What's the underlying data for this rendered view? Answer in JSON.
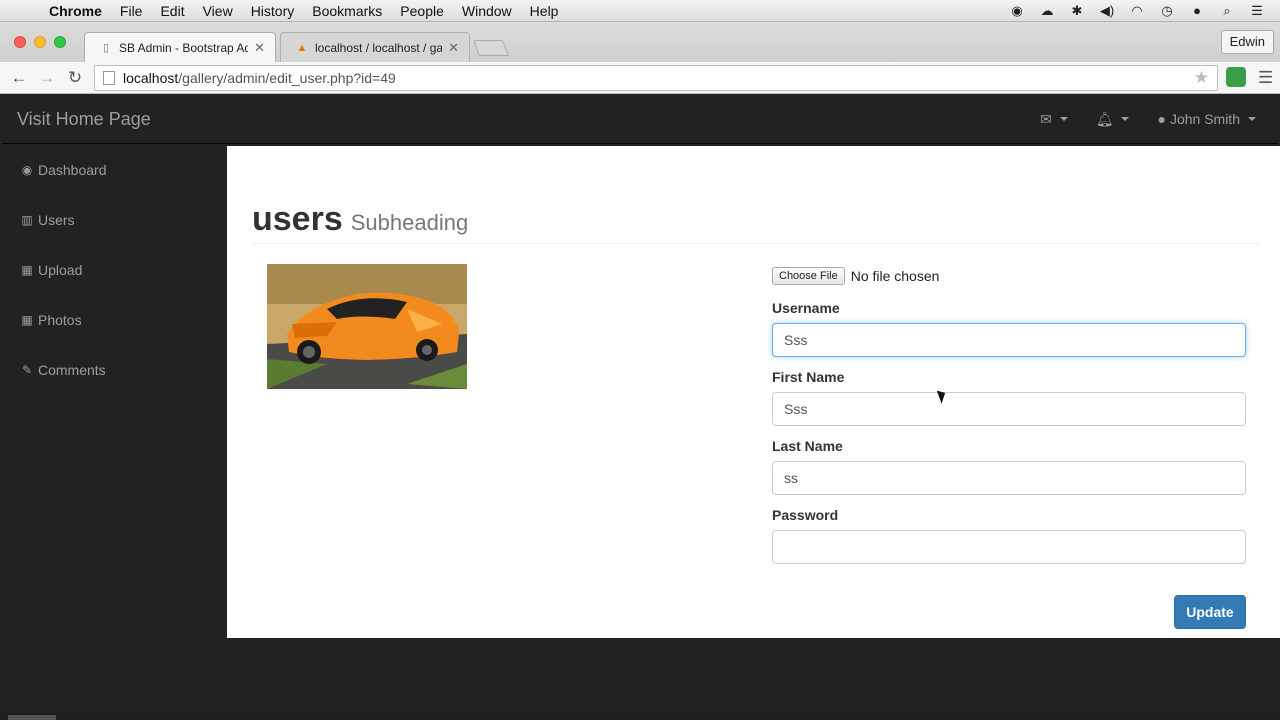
{
  "os_menubar": {
    "app": "Chrome",
    "items": [
      "File",
      "Edit",
      "View",
      "History",
      "Bookmarks",
      "People",
      "Window",
      "Help"
    ]
  },
  "browser": {
    "tabs": [
      {
        "title": "SB Admin - Bootstrap Adm",
        "active": true
      },
      {
        "title": "localhost / localhost / galle",
        "active": false
      }
    ],
    "profile": "Edwin",
    "url_host": "localhost",
    "url_path": "/gallery/admin/edit_user.php?id=49"
  },
  "topnav": {
    "brand": "Visit Home Page",
    "user": "John Smith"
  },
  "sidebar": {
    "items": [
      {
        "label": "Dashboard",
        "icon": "dashboard-icon"
      },
      {
        "label": "Users",
        "icon": "bar-chart-icon"
      },
      {
        "label": "Upload",
        "icon": "table-icon"
      },
      {
        "label": "Photos",
        "icon": "table-icon"
      },
      {
        "label": "Comments",
        "icon": "edit-icon"
      }
    ]
  },
  "main": {
    "title": "users",
    "subtitle": "Subheading",
    "file": {
      "button": "Choose File",
      "status": "No file chosen"
    },
    "fields": {
      "username": {
        "label": "Username",
        "value": "Sss"
      },
      "first_name": {
        "label": "First Name",
        "value": "Sss"
      },
      "last_name": {
        "label": "Last Name",
        "value": "ss"
      },
      "password": {
        "label": "Password",
        "value": ""
      }
    },
    "update_label": "Update"
  },
  "colors": {
    "primary": "#337ab7",
    "navbar": "#222222",
    "car": "#f28a1e"
  }
}
